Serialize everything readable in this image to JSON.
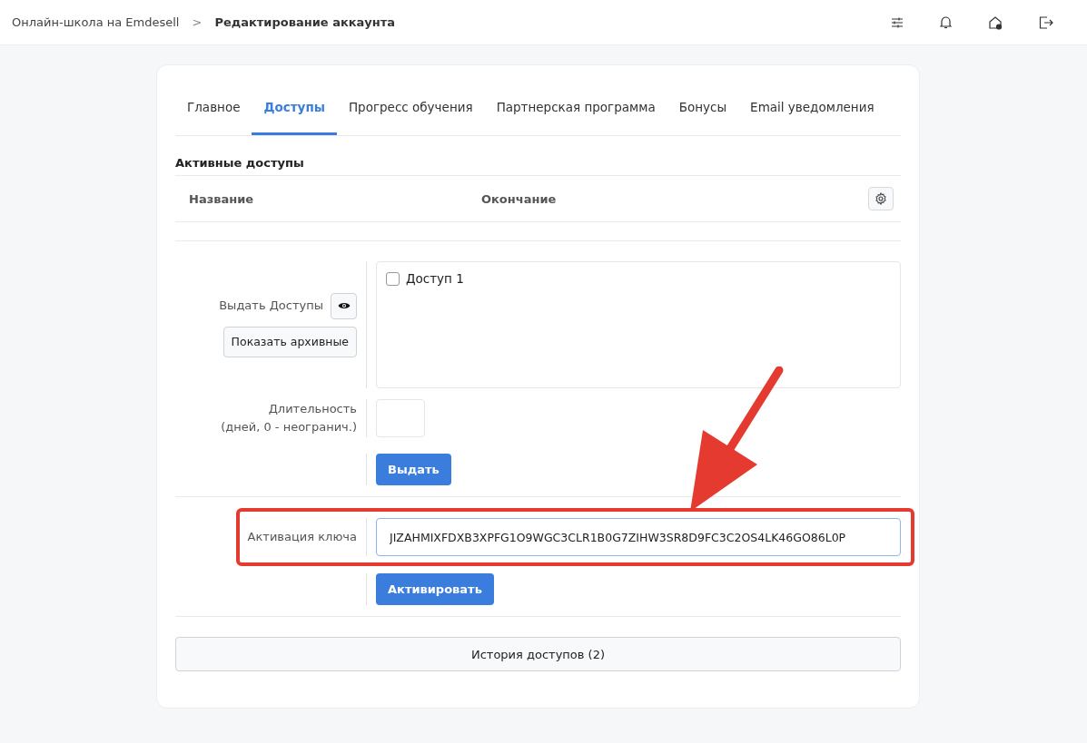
{
  "breadcrumb": {
    "parent": "Онлайн-школа на Emdesell",
    "separator": ">",
    "current": "Редактирование аккаунта"
  },
  "tabs": [
    {
      "label": "Главное",
      "selected": false
    },
    {
      "label": "Доступы",
      "selected": true
    },
    {
      "label": "Прогресс обучения",
      "selected": false
    },
    {
      "label": "Партнерская программа",
      "selected": false
    },
    {
      "label": "Бонусы",
      "selected": false
    },
    {
      "label": "Email уведомления",
      "selected": false
    }
  ],
  "active_access": {
    "title": "Активные доступы",
    "columns": [
      "Название",
      "Окончание"
    ]
  },
  "grant": {
    "label": "Выдать Доступы",
    "archive_button": "Показать архивные",
    "options": [
      {
        "label": "Доступ 1",
        "checked": false
      }
    ],
    "duration_label": "Длительность",
    "duration_hint": "(дней, 0 - неогранич.)",
    "submit": "Выдать"
  },
  "key_activation": {
    "label": "Активация ключа",
    "value": "JIZAHMIXFDXB3XPFG1O9WGC3CLR1B0G7ZIHW3SR8D9FC3C2OS4LK46GO86L0P",
    "submit": "Активировать"
  },
  "history_button": "История доступов (2)"
}
